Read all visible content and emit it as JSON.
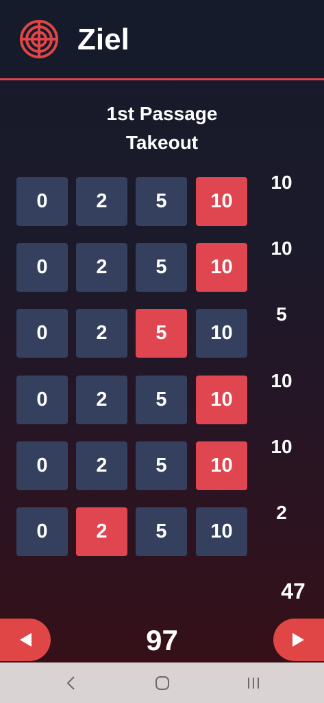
{
  "app": {
    "title": "Ziel",
    "logo_icon": "target-icon",
    "accent_color": "#e04646"
  },
  "section": {
    "title_line1": "1st Passage",
    "title_line2": "Takeout"
  },
  "options": [
    "0",
    "2",
    "5",
    "10"
  ],
  "rows": [
    {
      "selected": "10",
      "score": "10"
    },
    {
      "selected": "10",
      "score": "10"
    },
    {
      "selected": "5",
      "score": "5"
    },
    {
      "selected": "10",
      "score": "10"
    },
    {
      "selected": "10",
      "score": "10"
    },
    {
      "selected": "2",
      "score": "2"
    }
  ],
  "subtotal": "47",
  "total": "97",
  "nav": {
    "prev_icon": "arrow-left-icon",
    "next_icon": "arrow-right-icon"
  },
  "system_nav": {
    "back_icon": "back-chevron-icon",
    "home_icon": "home-icon",
    "recents_icon": "recent-apps-icon"
  }
}
